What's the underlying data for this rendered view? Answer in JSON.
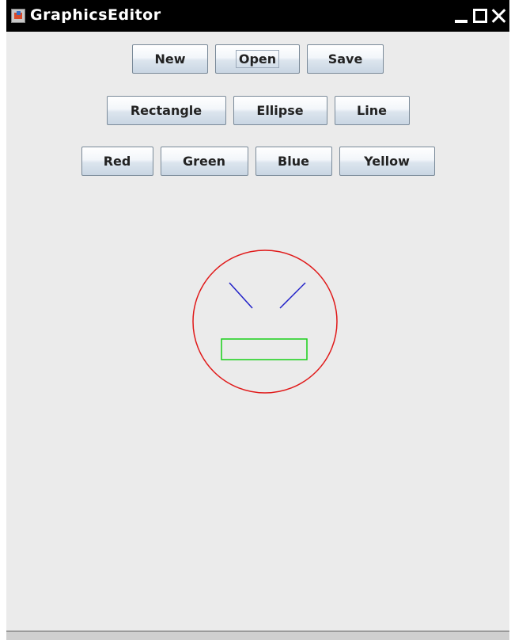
{
  "window": {
    "title": "GraphicsEditor"
  },
  "toolbar": {
    "file_buttons": [
      "New",
      "Open",
      "Save"
    ],
    "shape_buttons": [
      "Rectangle",
      "Ellipse",
      "Line"
    ],
    "color_buttons": [
      "Red",
      "Green",
      "Blue",
      "Yellow"
    ],
    "focused_button": "Open"
  },
  "drawing": {
    "shapes": [
      {
        "type": "ellipse",
        "color": "#e01818"
      },
      {
        "type": "line",
        "color": "#2020c8"
      },
      {
        "type": "line",
        "color": "#2020c8"
      },
      {
        "type": "rectangle",
        "color": "#18d018"
      }
    ]
  },
  "colors": {
    "titlebar": "#000000",
    "panel_background": "#ebebeb"
  }
}
